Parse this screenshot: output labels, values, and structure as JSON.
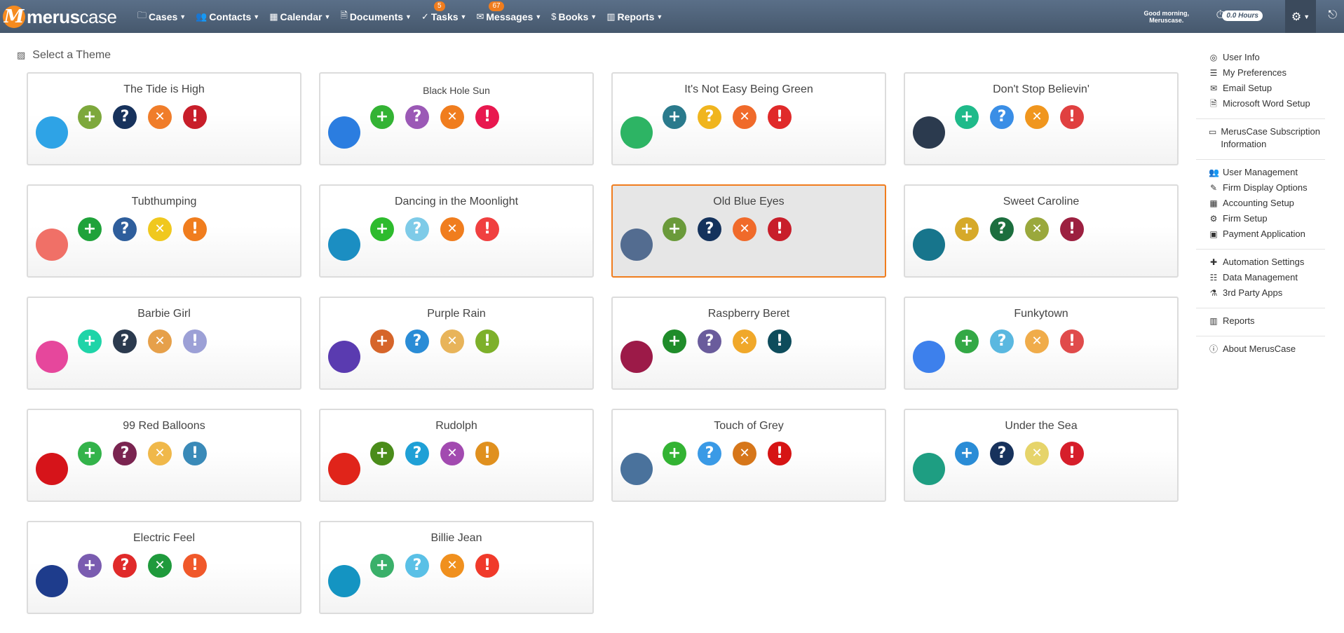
{
  "app": {
    "logo_mark": "M",
    "logo_bold": "merus",
    "logo_light": "case"
  },
  "nav": [
    {
      "label": "Cases",
      "icon": "folder-icon",
      "glyph": "🗀"
    },
    {
      "label": "Contacts",
      "icon": "users-icon",
      "glyph": "👥"
    },
    {
      "label": "Calendar",
      "icon": "calendar-icon",
      "glyph": "▦"
    },
    {
      "label": "Documents",
      "icon": "document-icon",
      "glyph": "🗎"
    },
    {
      "label": "Tasks",
      "icon": "check-circle-icon",
      "glyph": "✓",
      "badge": "5"
    },
    {
      "label": "Messages",
      "icon": "envelope-icon",
      "glyph": "✉",
      "badge": "67"
    },
    {
      "label": "Books",
      "icon": "dollar-icon",
      "glyph": "$"
    },
    {
      "label": "Reports",
      "icon": "bar-chart-icon",
      "glyph": "▥"
    }
  ],
  "header": {
    "greeting_line1": "Good morning,",
    "greeting_line2": "Meruscase.",
    "hours": "0.0 Hours"
  },
  "section_title": "Select a Theme",
  "themes": [
    {
      "name": "The Tide is High",
      "main": "#2ea3e6",
      "icons": [
        "#7da83c",
        "#17325c",
        "#f07d2a",
        "#c81e2a"
      ],
      "xcolor": "#fff",
      "selected": false
    },
    {
      "name": "Black Hole Sun",
      "main": "#2b7de0",
      "icons": [
        "#33b334",
        "#9b59b6",
        "#f07d1e",
        "#e8184f"
      ],
      "selected": false,
      "small": true
    },
    {
      "name": "It's Not Easy Being Green",
      "main": "#2db464",
      "icons": [
        "#2a7a8c",
        "#f0b51e",
        "#f06a2a",
        "#e02a2a"
      ],
      "selected": false
    },
    {
      "name": "Don't Stop Believin'",
      "main": "#2b3a4e",
      "icons": [
        "#1fba8a",
        "#3a8ee6",
        "#f0961e",
        "#e04040"
      ],
      "selected": false
    },
    {
      "name": "Tubthumping",
      "main": "#f07067",
      "icons": [
        "#1fa23a",
        "#2e5e9c",
        "#f0c81e",
        "#f07d1e"
      ],
      "selected": false
    },
    {
      "name": "Dancing in the Moonlight",
      "main": "#1b8ec2",
      "icons": [
        "#2dbb2d",
        "#7ecbe8",
        "#f07d1e",
        "#f04040"
      ],
      "selected": false
    },
    {
      "name": "Old Blue Eyes",
      "main": "#536c90",
      "icons": [
        "#6a9a3a",
        "#14325c",
        "#f06a2a",
        "#c81e2a"
      ],
      "selected": true
    },
    {
      "name": "Sweet Caroline",
      "main": "#17758c",
      "icons": [
        "#d6a92a",
        "#1c6e3e",
        "#9aa83c",
        "#9c2040"
      ],
      "selected": false
    },
    {
      "name": "Barbie Girl",
      "main": "#e6479c",
      "icons": [
        "#1fd4a8",
        "#2b3a4e",
        "#e6a04a",
        "#9ca0d6"
      ],
      "selected": false
    },
    {
      "name": "Purple Rain",
      "main": "#5a3bb0",
      "icons": [
        "#d6652a",
        "#2a8cd6",
        "#e8b45a",
        "#7db02a"
      ],
      "selected": false
    },
    {
      "name": "Raspberry Beret",
      "main": "#9c1a48",
      "icons": [
        "#1f8c2a",
        "#6a5c9c",
        "#f0a82a",
        "#0e4c5c"
      ],
      "selected": false
    },
    {
      "name": "Funkytown",
      "main": "#3d80ec",
      "icons": [
        "#33a845",
        "#5ab8e0",
        "#f0ac4a",
        "#e04b4b"
      ],
      "selected": false
    },
    {
      "name": "99 Red Balloons",
      "main": "#d6141a",
      "icons": [
        "#33b34a",
        "#7a2450",
        "#f0b84a",
        "#3a8ab8"
      ],
      "selected": false
    },
    {
      "name": "Rudolph",
      "main": "#e0241a",
      "icons": [
        "#4a8c1a",
        "#1fa0d6",
        "#a24ab0",
        "#e0901e"
      ],
      "selected": false
    },
    {
      "name": "Touch of Grey",
      "main": "#4a729c",
      "icons": [
        "#33b333",
        "#3a9ae6",
        "#d6761a",
        "#d61414"
      ],
      "selected": false
    },
    {
      "name": "Under the Sea",
      "main": "#1e9e82",
      "icons": [
        "#2a8cd6",
        "#17325c",
        "#e6d46a",
        "#d61e2a"
      ],
      "selected": false
    },
    {
      "name": "Electric Feel",
      "main": "#1e3c8c",
      "icons": [
        "#7a5cb0",
        "#e02a2a",
        "#1f9a3c",
        "#f0582a"
      ],
      "selected": false
    },
    {
      "name": "Billie Jean",
      "main": "#1494c2",
      "icons": [
        "#3ab06a",
        "#5ac0e6",
        "#f0901e",
        "#f03a2a"
      ],
      "selected": false
    }
  ],
  "icon_glyphs": [
    "+",
    "?",
    "✕",
    "!"
  ],
  "icon_names": [
    "plus-icon",
    "question-icon",
    "x-icon",
    "exclamation-icon"
  ],
  "sidebar": [
    [
      {
        "label": "User Info",
        "icon": "user-circle-icon",
        "glyph": "◎"
      },
      {
        "label": "My Preferences",
        "icon": "sliders-icon",
        "glyph": "☰"
      },
      {
        "label": "Email Setup",
        "icon": "envelope-icon",
        "glyph": "✉"
      },
      {
        "label": "Microsoft Word Setup",
        "icon": "word-file-icon",
        "glyph": "🗎"
      }
    ],
    [
      {
        "label": "MerusCase Subscription Information",
        "icon": "credit-card-icon",
        "glyph": "▭"
      }
    ],
    [
      {
        "label": "User Management",
        "icon": "users-icon",
        "glyph": "👥"
      },
      {
        "label": "Firm Display Options",
        "icon": "paintbrush-icon",
        "glyph": "✎"
      },
      {
        "label": "Accounting Setup",
        "icon": "calculator-icon",
        "glyph": "▦"
      },
      {
        "label": "Firm Setup",
        "icon": "cogs-icon",
        "glyph": "⚙"
      },
      {
        "label": "Payment Application",
        "icon": "money-icon",
        "glyph": "▣"
      }
    ],
    [
      {
        "label": "Automation Settings",
        "icon": "puzzle-icon",
        "glyph": "✚"
      },
      {
        "label": "Data Management",
        "icon": "database-icon",
        "glyph": "☷"
      },
      {
        "label": "3rd Party Apps",
        "icon": "flask-icon",
        "glyph": "⚗"
      }
    ],
    [
      {
        "label": "Reports",
        "icon": "bar-chart-icon",
        "glyph": "▥"
      }
    ],
    [
      {
        "label": "About MerusCase",
        "icon": "info-icon",
        "glyph": "ⓘ"
      }
    ]
  ]
}
